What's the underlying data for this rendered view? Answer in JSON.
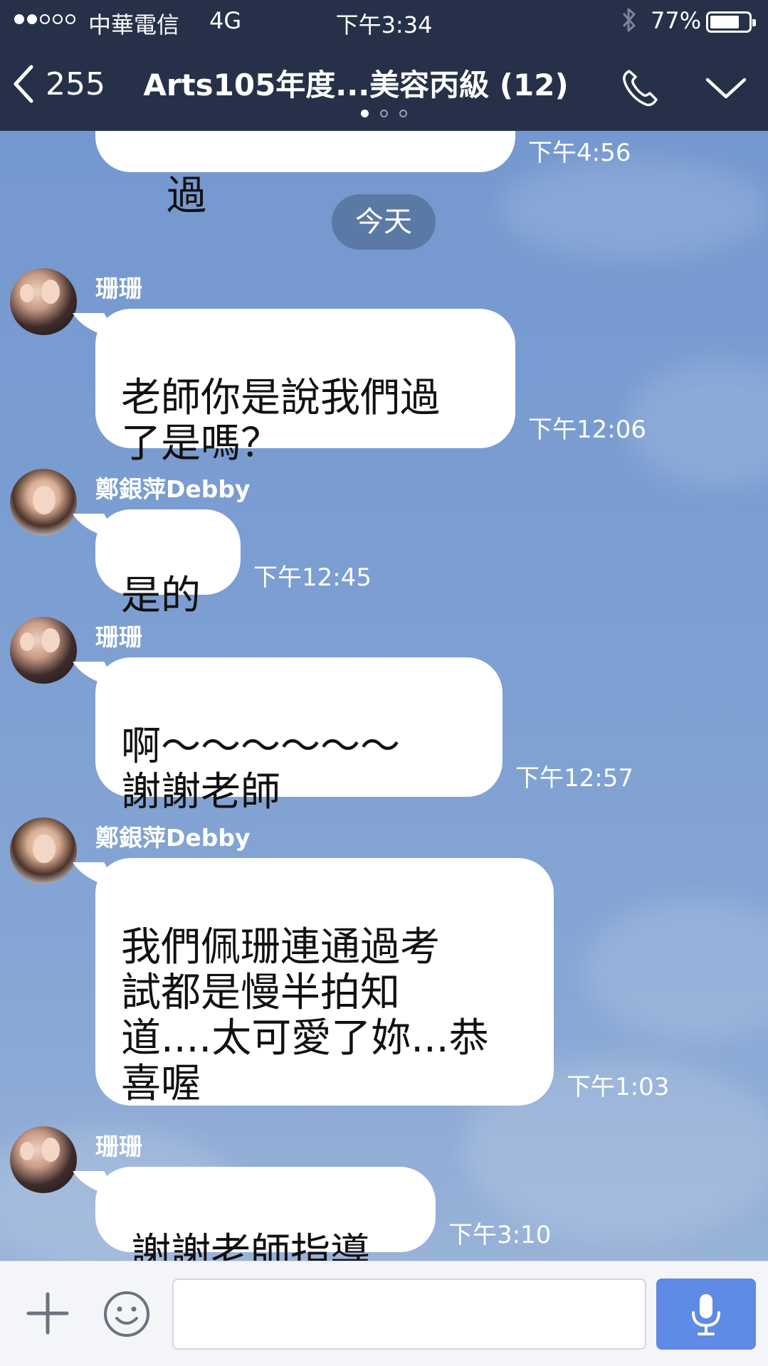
{
  "status_bar": {
    "carrier": "中華電信",
    "network": "4G",
    "time": "下午3:34",
    "battery": "77%",
    "battery_level": 0.77
  },
  "header": {
    "back_count": "255",
    "title": "Arts105年度...美容丙級 (12)",
    "page_indicator": {
      "count": 3,
      "active": 1
    },
    "icons": [
      "chevron-left-icon",
      "phone-icon",
      "chevron-down-icon"
    ]
  },
  "chat": {
    "top_partial": {
      "text": "過",
      "time": "下午4:56"
    },
    "date_label": "今天",
    "messages": [
      {
        "sender": "珊珊",
        "text": "老師你是說我們過\n了是嗎？",
        "time": "下午12:06"
      },
      {
        "sender": "鄭銀萍Debby",
        "text": "是的",
        "time": "下午12:45"
      },
      {
        "sender": "珊珊",
        "text": "  啊～～～～～～\n謝謝老師",
        "time": "下午12:57"
      },
      {
        "sender": "鄭銀萍Debby",
        "text": "我們佩珊連通過考\n試都是慢半拍知\n道....太可愛了妳...恭\n喜喔",
        "time": "下午1:03"
      },
      {
        "sender": "珊珊",
        "text": "謝謝老師指導",
        "time": "下午3:10"
      }
    ]
  },
  "input_bar": {
    "message_value": "",
    "icons": [
      "plus-icon",
      "emoji-icon",
      "microphone-icon"
    ]
  },
  "colors": {
    "header_bg": "#263149",
    "chat_bg": "#7d9fd2",
    "bubble": "#ffffff",
    "send_button": "#5f8ae6"
  }
}
